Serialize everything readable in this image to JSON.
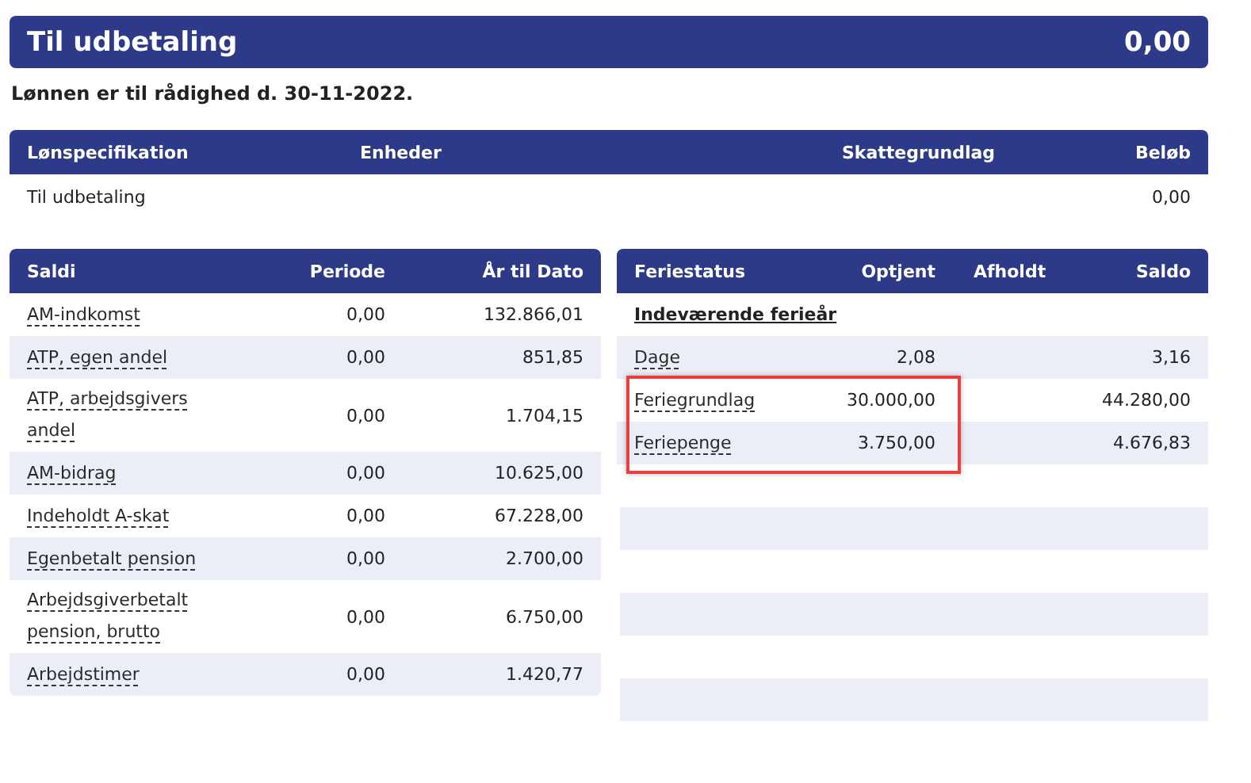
{
  "payout": {
    "title": "Til udbetaling",
    "amount": "0,00"
  },
  "availability_note": "Lønnen er til rådighed d. 30-11-2022.",
  "salary_spec": {
    "columns": [
      "Lønspecifikation",
      "Enheder",
      "Skattegrundlag",
      "Beløb"
    ],
    "rows": [
      {
        "cells": [
          "Til udbetaling",
          "",
          "",
          "0,00"
        ]
      }
    ]
  },
  "balances": {
    "columns": [
      "Saldi",
      "Periode",
      "År til Dato"
    ],
    "rows": [
      {
        "label": "AM-indkomst",
        "period": "0,00",
        "ytd": "132.866,01"
      },
      {
        "label": "ATP, egen andel",
        "period": "0,00",
        "ytd": "851,85"
      },
      {
        "label": "ATP, arbejdsgivers andel",
        "period": "0,00",
        "ytd": "1.704,15"
      },
      {
        "label": "AM-bidrag",
        "period": "0,00",
        "ytd": "10.625,00"
      },
      {
        "label": "Indeholdt A-skat",
        "period": "0,00",
        "ytd": "67.228,00"
      },
      {
        "label": "Egenbetalt pension",
        "period": "0,00",
        "ytd": "2.700,00"
      },
      {
        "label": "Arbejdsgiverbetalt pension, brutto",
        "period": "0,00",
        "ytd": "6.750,00"
      },
      {
        "label": "Arbejdstimer",
        "period": "0,00",
        "ytd": "1.420,77"
      }
    ]
  },
  "holiday_status": {
    "columns": [
      "Feriestatus",
      "Optjent",
      "Afholdt",
      "Saldo"
    ],
    "section": "Indeværende ferieår",
    "rows": [
      {
        "label": "Dage",
        "earned": "2,08",
        "saldo": "3,16",
        "highlighted": false
      },
      {
        "label": "Feriegrundlag",
        "earned": "30.000,00",
        "saldo": "44.280,00",
        "highlighted": true
      },
      {
        "label": "Feriepenge",
        "earned": "3.750,00",
        "saldo": "4.676,83",
        "highlighted": true
      }
    ]
  }
}
